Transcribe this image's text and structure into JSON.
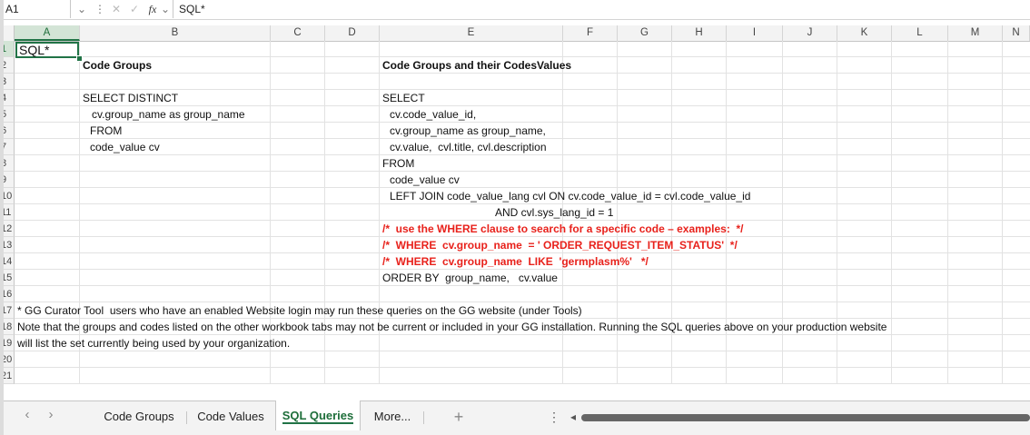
{
  "formula_bar": {
    "name_box": "A1",
    "cancel_glyph": "✕",
    "confirm_glyph": "✓",
    "fx_label": "fx",
    "content": "SQL*"
  },
  "columns": [
    "A",
    "B",
    "C",
    "D",
    "E",
    "F",
    "G",
    "H",
    "I",
    "J",
    "K",
    "L",
    "M",
    "N"
  ],
  "rows": [
    "1",
    "2",
    "3",
    "4",
    "5",
    "6",
    "7",
    "8",
    "9",
    "10",
    "11",
    "12",
    "13",
    "14",
    "15",
    "16",
    "17",
    "18",
    "19",
    "20",
    "21"
  ],
  "cells": {
    "A1": "SQL*",
    "B2": "Code Groups",
    "E2": "Code Groups and their CodesValues",
    "B4": "SELECT DISTINCT",
    "B5": "cv.group_name as group_name",
    "B6": "FROM",
    "B7": "code_value cv",
    "E4": "SELECT",
    "E5": "cv.code_value_id,",
    "E6": "cv.group_name as group_name,",
    "E7": "cv.value,  cvl.title, cvl.description",
    "E8": "FROM",
    "E9": "code_value cv",
    "E10": "LEFT JOIN code_value_lang cvl ON cv.code_value_id = cvl.code_value_id",
    "E11": "AND cvl.sys_lang_id = 1",
    "E12": "/*  use the WHERE clause to search for a specific code – examples:  */",
    "E13": "/*  WHERE  cv.group_name  = ' ORDER_REQUEST_ITEM_STATUS'  */",
    "E14": "/*  WHERE  cv.group_name  LIKE  'germplasm%'   */",
    "E15": "ORDER BY  group_name,   cv.value",
    "A17": "* GG Curator Tool  users who have an enabled Website login may run these queries on the GG website (under Tools)",
    "A18": "Note that the groups and codes listed on the other workbook tabs may not be current or included in your GG installation. Running the SQL queries above on your production website",
    "A19": "will list the set currently being used by your organization."
  },
  "tabs": {
    "prev": "‹",
    "next": "›",
    "items": [
      "Code Groups",
      "Code Values",
      "SQL Queries",
      "More..."
    ],
    "active": "SQL Queries",
    "add": "+",
    "menu": "⋮",
    "scroll_left": "◂"
  },
  "colors": {
    "accent": "#217346",
    "comment_red": "#e8211b",
    "header_bg": "#f3f3f3"
  }
}
